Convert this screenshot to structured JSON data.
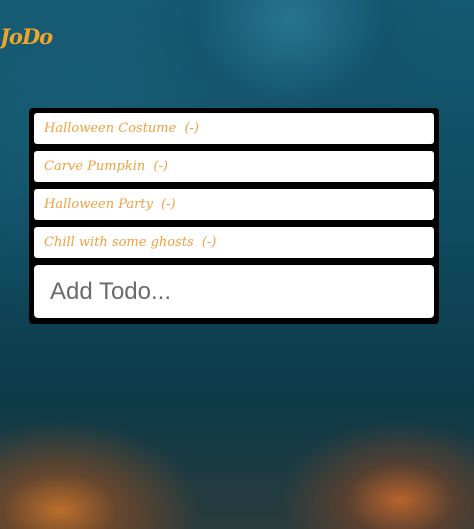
{
  "app": {
    "logo_text": "JoDo"
  },
  "todos": [
    {
      "label": "Halloween Costume",
      "remove_label": "(-)"
    },
    {
      "label": "Carve Pumpkin",
      "remove_label": "(-)"
    },
    {
      "label": "Halloween Party",
      "remove_label": "(-)"
    },
    {
      "label": "Chill with some ghosts",
      "remove_label": "(-)"
    }
  ],
  "add_input": {
    "placeholder": "Add Todo...",
    "value": ""
  },
  "colors": {
    "accent": "#f0a52a",
    "todo_text": "#f0a040",
    "panel": "#000000"
  }
}
